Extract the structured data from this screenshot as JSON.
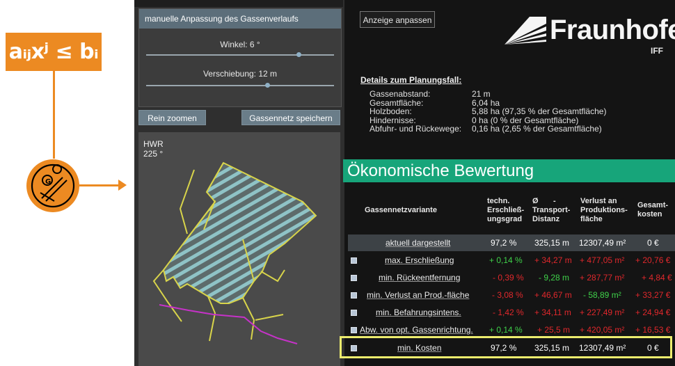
{
  "formula": {
    "text": "aᵢⱼxʲ ≤ bᵢ"
  },
  "panel": {
    "title": "manuelle Anpassung des Gassenverlaufs",
    "angle_label": "Winkel: 6 °",
    "angle_level": 0.82,
    "shift_label": "Verschiebung: 12 m",
    "shift_level": 0.65
  },
  "buttons": {
    "zoom": "Rein zoomen",
    "save": "Gassennetz speichern",
    "display": "Anzeige anpassen"
  },
  "map": {
    "line1": "HWR",
    "line2": "225 °"
  },
  "logo": {
    "name": "Fraunhofer",
    "sub": "IFF"
  },
  "details": {
    "title": "Details zum Planungsfall:",
    "rows": [
      {
        "key": "Gassenabstand:",
        "value": "21 m"
      },
      {
        "key": "Gesamtfläche:",
        "value": "6,04 ha"
      },
      {
        "key": "Holzboden:",
        "value": "5,88 ha (97,35 % der Gesamtfläche)"
      },
      {
        "key": "Hindernisse:",
        "value": "0 ha (0 % der Gesamtfläche)"
      },
      {
        "key": "Abfuhr- und Rückewege:",
        "value": "0,16 ha (2,65 % der Gesamtfläche)"
      }
    ]
  },
  "section_title": "Ökonomische Bewertung",
  "table": {
    "headers": {
      "variant": "Gassennetzvariante",
      "c1a": "techn.",
      "c1b": "Erschließ-",
      "c1c": "ungsgrad",
      "c2a": "Ø       -",
      "c2b": "Transport-",
      "c2c": "Distanz",
      "c3a": "Verlust an",
      "c3b": "Produktions-",
      "c3c": "fläche",
      "c4a": "Gesamt-",
      "c4b": "kosten"
    },
    "rows": [
      {
        "name": "aktuell dargestellt",
        "v1": "97,2 %",
        "v2": "325,15 m",
        "v3": "12307,49 m²",
        "v4": "0 €",
        "c1": "w",
        "c2": "w",
        "c3": "w",
        "c4": "w"
      },
      {
        "name": "max. Erschließung",
        "v1": "+ 0,14 %",
        "v2": "+ 34,27 m",
        "v3": "+ 477,05 m²",
        "v4": "+ 20,76 €",
        "c1": "g",
        "c2": "r",
        "c3": "r",
        "c4": "r"
      },
      {
        "name": "min. Rückeentfernung",
        "v1": "- 0,39 %",
        "v2": "- 9,28 m",
        "v3": "+ 287,77 m²",
        "v4": "+ 4,84 €",
        "c1": "r",
        "c2": "g",
        "c3": "r",
        "c4": "r"
      },
      {
        "name": "min. Verlust an Prod.-fläche",
        "v1": "- 3,08 %",
        "v2": "+ 46,67 m",
        "v3": "- 58,89 m²",
        "v4": "+ 33,27 €",
        "c1": "r",
        "c2": "r",
        "c3": "g",
        "c4": "r"
      },
      {
        "name": "min. Befahrungsintens.",
        "v1": "- 1,42 %",
        "v2": "+ 34,11 m",
        "v3": "+ 227,49 m²",
        "v4": "+ 24,94 €",
        "c1": "r",
        "c2": "r",
        "c3": "r",
        "c4": "r"
      },
      {
        "name": "Abw. von opt. Gassenrichtung.",
        "v1": "+ 0,14 %",
        "v2": "+ 25,5 m",
        "v3": "+ 420,05 m²",
        "v4": "+ 16,53 €",
        "c1": "g",
        "c2": "r",
        "c3": "r",
        "c4": "r"
      },
      {
        "name": "min. Kosten",
        "v1": "97,2 %",
        "v2": "325,15 m",
        "v3": "12307,49 m²",
        "v4": "0 €",
        "c1": "w",
        "c2": "w",
        "c3": "w",
        "c4": "w"
      }
    ]
  },
  "colors": {
    "accent_orange": "#ec8a22",
    "section_green": "#17a57a",
    "positive": "#3fd24a",
    "negative": "#e0282c",
    "highlight_box": "#ecec6e",
    "hatch": "#8fc3c6"
  }
}
